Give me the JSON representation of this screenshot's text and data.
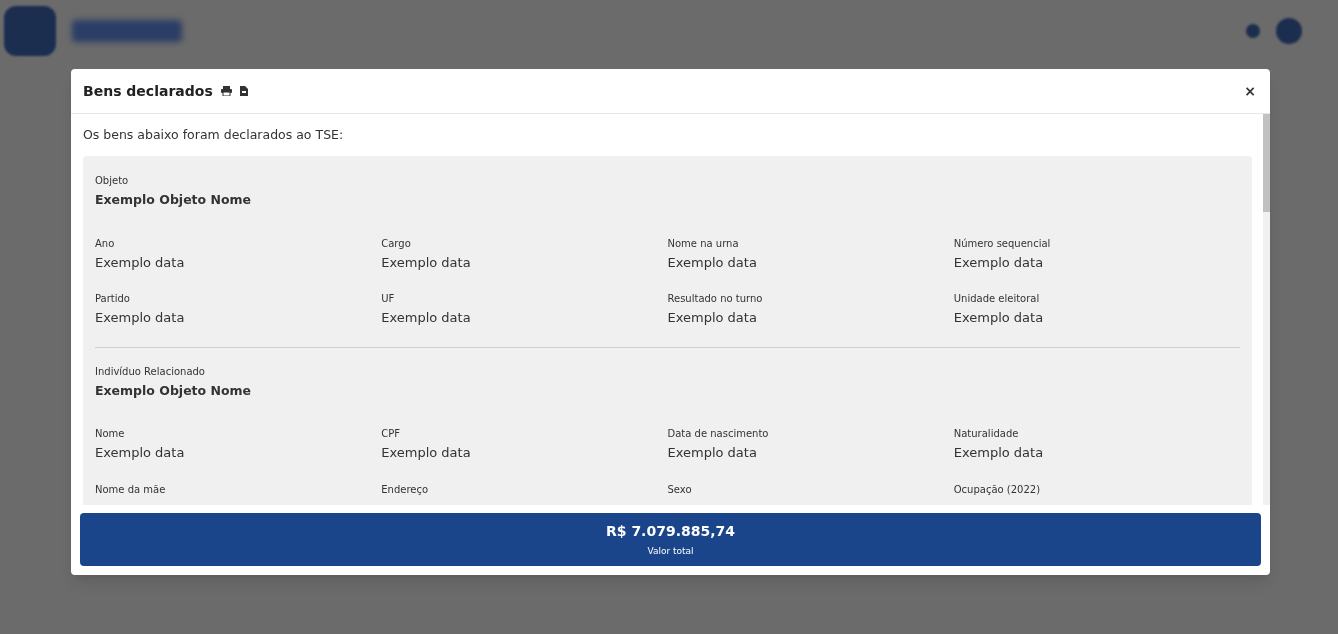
{
  "modal": {
    "title": "Bens declarados",
    "intro": "Os bens abaixo foram declarados ao TSE:",
    "close": "×",
    "sections": [
      {
        "label": "Objeto",
        "name": "Exemplo Objeto Nome",
        "fields": [
          {
            "label": "Ano",
            "value": "Exemplo data"
          },
          {
            "label": "Cargo",
            "value": "Exemplo data"
          },
          {
            "label": "Nome na urna",
            "value": "Exemplo data"
          },
          {
            "label": "Número sequencial",
            "value": "Exemplo data"
          },
          {
            "label": "Partido",
            "value": "Exemplo data"
          },
          {
            "label": "UF",
            "value": "Exemplo data"
          },
          {
            "label": "Resultado no turno",
            "value": "Exemplo data"
          },
          {
            "label": "Unidade eleitoral",
            "value": "Exemplo data"
          }
        ]
      },
      {
        "label": "Indivíduo Relacionado",
        "name": "Exemplo Objeto Nome",
        "fields": [
          {
            "label": "Nome",
            "value": "Exemplo data"
          },
          {
            "label": "CPF",
            "value": "Exemplo data"
          },
          {
            "label": "Data de nascimento",
            "value": "Exemplo data"
          },
          {
            "label": "Naturalidade",
            "value": "Exemplo data"
          },
          {
            "label": "Nome da mãe"
          },
          {
            "label": "Endereço"
          },
          {
            "label": "Sexo"
          },
          {
            "label": "Ocupação (2022)"
          }
        ]
      }
    ],
    "total": {
      "amount": "R$ 7.079.885,74",
      "caption": "Valor total"
    }
  }
}
